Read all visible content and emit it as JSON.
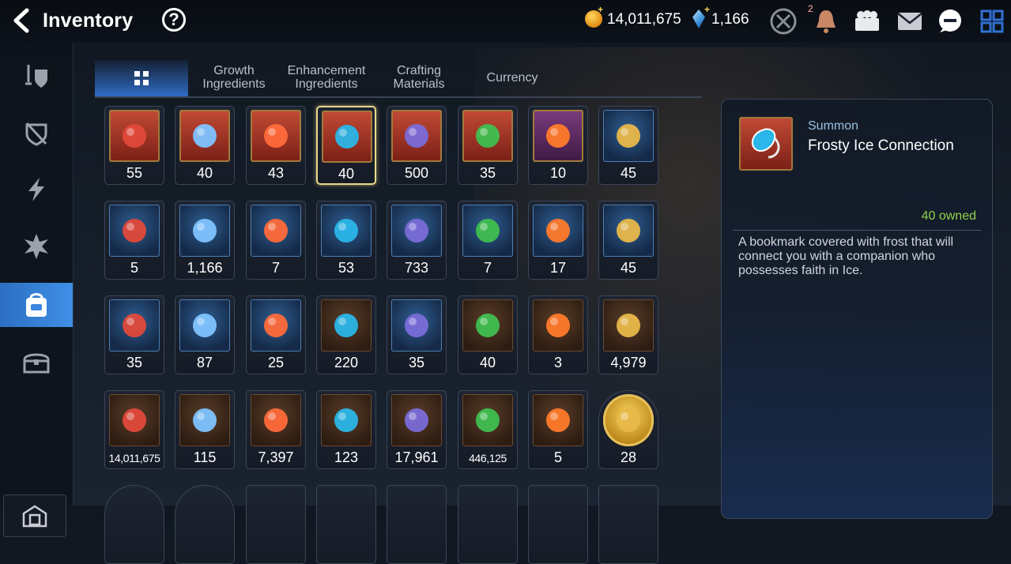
{
  "header": {
    "title": "Inventory",
    "help_label": "?",
    "gold": "14,011,675",
    "crystals": "1,166",
    "notification_count": "2"
  },
  "sidebar": {
    "items": [
      {
        "icon": "equipment-icon"
      },
      {
        "icon": "artifact-icon"
      },
      {
        "icon": "catalyst-icon"
      },
      {
        "icon": "rune-icon"
      },
      {
        "icon": "bag-icon",
        "active": true
      },
      {
        "icon": "chest-icon"
      }
    ],
    "bottom_icon": "storage-icon"
  },
  "tabs": [
    {
      "label": "",
      "icon": "grid-icon",
      "active": true
    },
    {
      "label": "Growth\nIngredients"
    },
    {
      "label": "Enhancement\nIngredients"
    },
    {
      "label": "Crafting\nMaterials"
    },
    {
      "label": "Currency"
    }
  ],
  "items": [
    {
      "qty": "55",
      "frame": "red",
      "icon": "red-gem-icon"
    },
    {
      "qty": "40",
      "frame": "red",
      "icon": "eye-charm-icon"
    },
    {
      "qty": "43",
      "frame": "red",
      "icon": "fire-bookmark-icon"
    },
    {
      "qty": "40",
      "frame": "red",
      "icon": "ice-bookmark-icon",
      "selected": true
    },
    {
      "qty": "500",
      "frame": "red",
      "icon": "dark-ring-icon"
    },
    {
      "qty": "35",
      "frame": "red",
      "icon": "tree-bookmark-icon"
    },
    {
      "qty": "10",
      "frame": "purple",
      "icon": "moon-bookmark-icon"
    },
    {
      "qty": "45",
      "frame": "blue",
      "icon": "lantern-icon"
    },
    {
      "qty": "5",
      "frame": "blue",
      "icon": "purple-flame-icon"
    },
    {
      "qty": "1,166",
      "frame": "blue",
      "icon": "crystal-icon"
    },
    {
      "qty": "7",
      "frame": "blue",
      "icon": "book-icon"
    },
    {
      "qty": "53",
      "frame": "blue",
      "icon": "green-crystal-icon"
    },
    {
      "qty": "733",
      "frame": "blue",
      "icon": "leaf-icon"
    },
    {
      "qty": "7",
      "frame": "blue",
      "icon": "ticket-card-icon"
    },
    {
      "qty": "17",
      "frame": "blue",
      "icon": "pink-mountain-icon"
    },
    {
      "qty": "45",
      "frame": "blue",
      "icon": "fire-bookmark-icon"
    },
    {
      "qty": "35",
      "frame": "blue",
      "icon": "ice-bookmark-icon"
    },
    {
      "qty": "87",
      "frame": "blue",
      "icon": "star-bookmark-icon"
    },
    {
      "qty": "25",
      "frame": "blue",
      "icon": "green-star-bookmark-icon"
    },
    {
      "qty": "220",
      "frame": "brown",
      "icon": "card-icon"
    },
    {
      "qty": "35",
      "frame": "blue",
      "icon": "tree-bookmark-icon"
    },
    {
      "qty": "40",
      "frame": "brown",
      "icon": "red-bracelet-icon"
    },
    {
      "qty": "3",
      "frame": "brown",
      "icon": "purple-token-icon"
    },
    {
      "qty": "4,979",
      "frame": "brown",
      "icon": "green-heart-icon"
    },
    {
      "qty": "14,011,675",
      "frame": "brown",
      "icon": "gold-coin-icon",
      "small": true
    },
    {
      "qty": "115",
      "frame": "brown",
      "icon": "gold-hex-icon"
    },
    {
      "qty": "7,397",
      "frame": "brown",
      "icon": "fist-badge-icon"
    },
    {
      "qty": "123",
      "frame": "brown",
      "icon": "sword-banner-icon"
    },
    {
      "qty": "17,961",
      "frame": "brown",
      "icon": "knight-piece-icon"
    },
    {
      "qty": "446,125",
      "frame": "brown",
      "icon": "red-tulip-icon",
      "small": true
    },
    {
      "qty": "5",
      "frame": "brown",
      "icon": "clover-icon"
    },
    {
      "qty": "28",
      "frame": "gold",
      "icon": "mascot-icon",
      "round": true
    }
  ],
  "detail": {
    "category": "Summon",
    "name": "Frosty Ice Connection",
    "owned": "40 owned",
    "description": "A bookmark covered with frost that will connect you with a companion who possesses faith in Ice."
  },
  "colors": {
    "accent": "#3a86e0",
    "owned_green": "#8fd24a",
    "selected_border": "#e8d98a"
  }
}
